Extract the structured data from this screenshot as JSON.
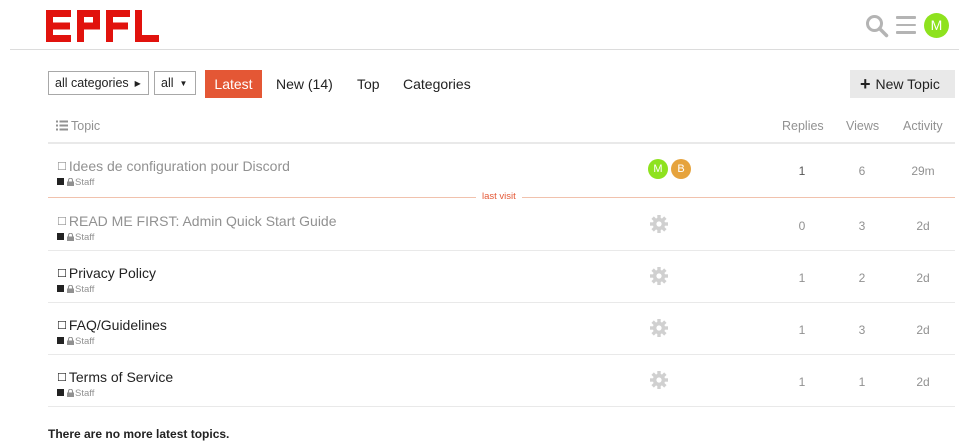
{
  "header": {
    "logo_text": "EPFL",
    "avatar_letter": "M",
    "brand_color": "#e1120d",
    "avatar_color": "#8ee21e"
  },
  "nav": {
    "category_dropdown": "all categories",
    "filter_dropdown": "all",
    "tabs": [
      {
        "label": "Latest",
        "active": true
      },
      {
        "label": "New (14)",
        "active": false
      },
      {
        "label": "Top",
        "active": false
      },
      {
        "label": "Categories",
        "active": false
      }
    ],
    "new_topic_label": "New Topic",
    "accent_color": "#e45735"
  },
  "table": {
    "headers": {
      "topic": "Topic",
      "replies": "Replies",
      "views": "Views",
      "activity": "Activity"
    },
    "last_visit_label": "last visit",
    "rows": [
      {
        "title": "Idees de configuration pour Discord",
        "category": "Staff",
        "visited": true,
        "posters": [
          {
            "letter": "M",
            "color": "#8ee21e"
          },
          {
            "letter": "B",
            "color": "#e6a33c"
          }
        ],
        "replies": "1",
        "views": "6",
        "activity": "29m"
      },
      {
        "title": "READ ME FIRST: Admin Quick Start Guide",
        "category": "Staff",
        "visited": true,
        "poster_icon": "gear-icon",
        "replies": "0",
        "views": "3",
        "activity": "2d"
      },
      {
        "title": "Privacy Policy",
        "category": "Staff",
        "visited": false,
        "poster_icon": "gear-icon",
        "replies": "1",
        "views": "2",
        "activity": "2d"
      },
      {
        "title": "FAQ/Guidelines",
        "category": "Staff",
        "visited": false,
        "poster_icon": "gear-icon",
        "replies": "1",
        "views": "3",
        "activity": "2d"
      },
      {
        "title": "Terms of Service",
        "category": "Staff",
        "visited": false,
        "poster_icon": "gear-icon",
        "replies": "1",
        "views": "1",
        "activity": "2d"
      }
    ]
  },
  "footer": {
    "message": "There are no more latest topics."
  }
}
